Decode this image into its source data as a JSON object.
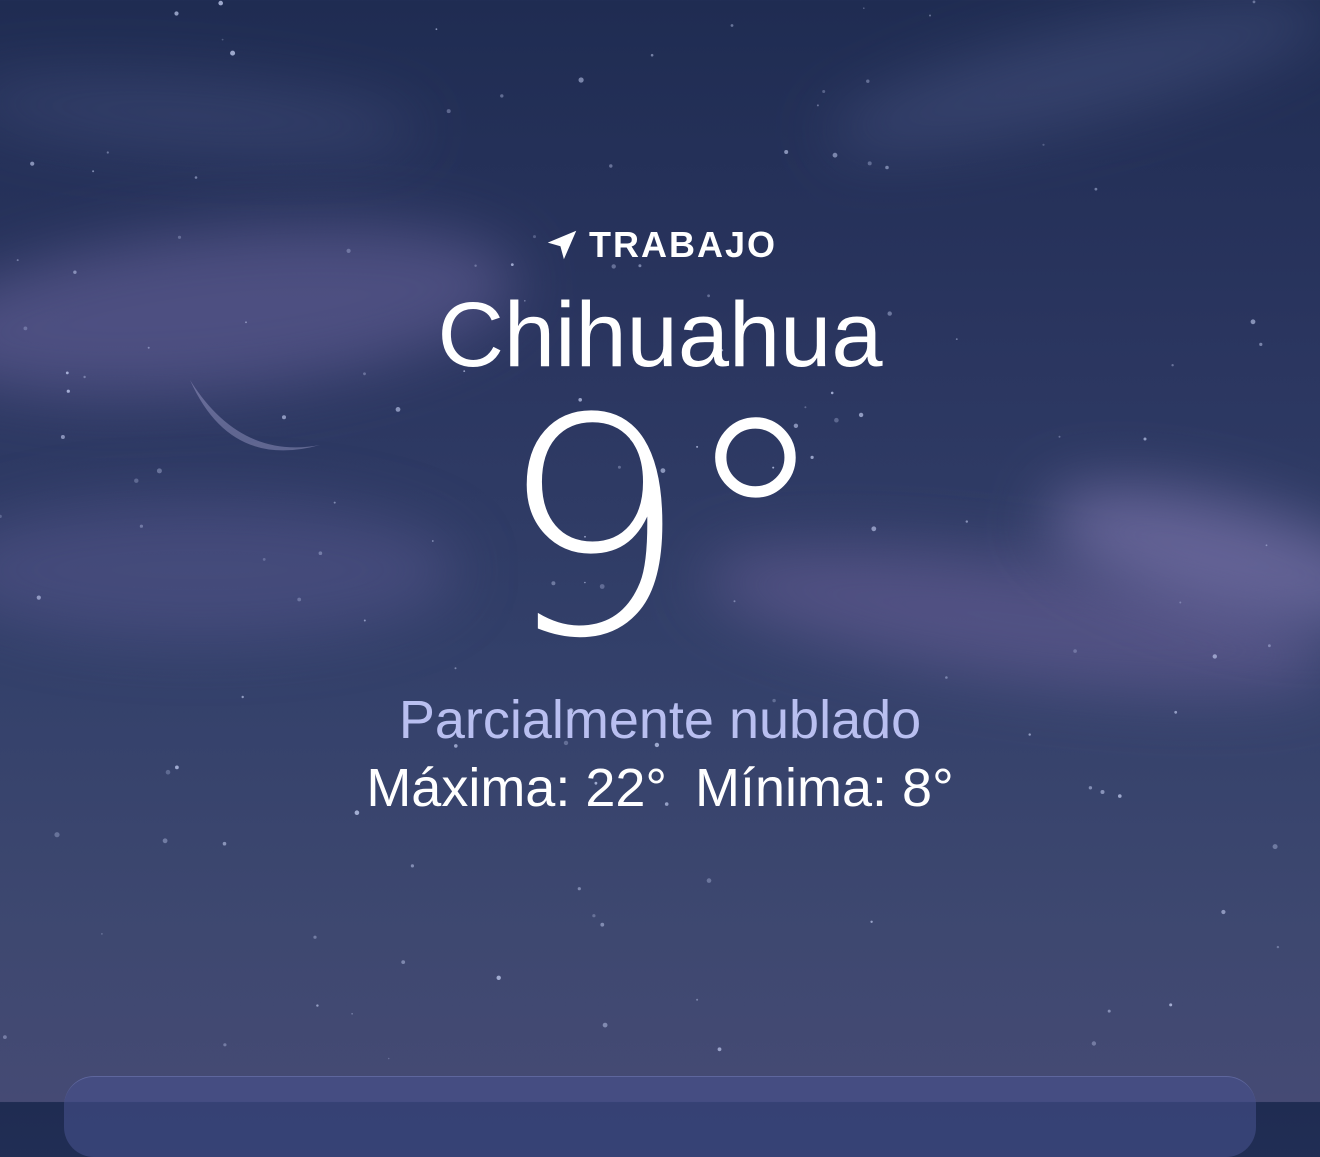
{
  "header": {
    "location_icon": "location-arrow-icon",
    "location_label": "TRABAJO",
    "city": "Chihuahua"
  },
  "current": {
    "temperature": "9°",
    "condition": "Parcialmente nublado",
    "high": "Máxima: 22°",
    "low": "Mínima: 8°"
  },
  "background": {
    "theme": "night-partly-cloudy",
    "colors": {
      "sky_top": "#1f2c52",
      "sky_bottom": "#454a74",
      "condition_text": "#b9bff0",
      "text": "#ffffff"
    }
  }
}
